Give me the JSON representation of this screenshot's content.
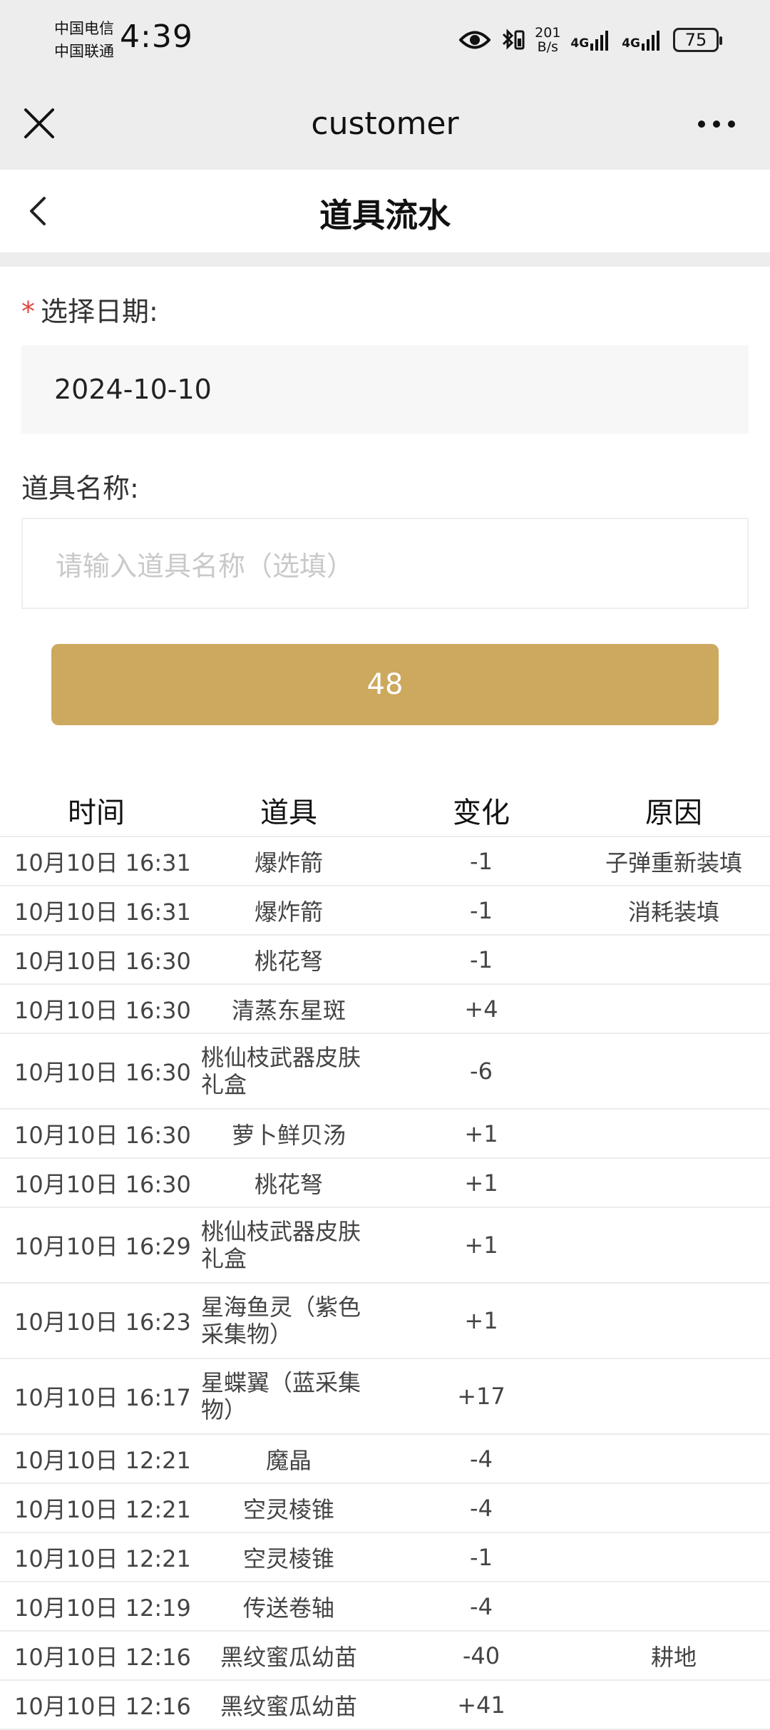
{
  "status": {
    "carrier1": "中国电信",
    "carrier2": "中国联通",
    "time": "4:39",
    "speed_value": "201",
    "speed_unit": "B/s",
    "net1": "4G",
    "net2": "4G",
    "battery": "75"
  },
  "nav": {
    "title": "customer"
  },
  "page": {
    "title": "道具流水"
  },
  "form": {
    "date_label": "选择日期:",
    "date_required": "*",
    "date_value": "2024-10-10",
    "name_label": "道具名称:",
    "name_placeholder": "请输入道具名称（选填）",
    "submit_label": "48"
  },
  "table": {
    "headers": {
      "time": "时间",
      "item": "道具",
      "change": "变化",
      "reason": "原因"
    },
    "rows": [
      {
        "time": "10月10日 16:31",
        "item": "爆炸箭",
        "change": "-1",
        "reason": "子弹重新装填"
      },
      {
        "time": "10月10日 16:31",
        "item": "爆炸箭",
        "change": "-1",
        "reason": "消耗装填"
      },
      {
        "time": "10月10日 16:30",
        "item": "桃花弩",
        "change": "-1",
        "reason": ""
      },
      {
        "time": "10月10日 16:30",
        "item": "清蒸东星斑",
        "change": "+4",
        "reason": ""
      },
      {
        "time": "10月10日 16:30",
        "item": "桃仙枝武器皮肤礼盒",
        "change": "-6",
        "reason": ""
      },
      {
        "time": "10月10日 16:30",
        "item": "萝卜鲜贝汤",
        "change": "+1",
        "reason": ""
      },
      {
        "time": "10月10日 16:30",
        "item": "桃花弩",
        "change": "+1",
        "reason": ""
      },
      {
        "time": "10月10日 16:29",
        "item": "桃仙枝武器皮肤礼盒",
        "change": "+1",
        "reason": ""
      },
      {
        "time": "10月10日 16:23",
        "item": "星海鱼灵（紫色采集物）",
        "change": "+1",
        "reason": ""
      },
      {
        "time": "10月10日 16:17",
        "item": "星蝶翼（蓝采集物）",
        "change": "+17",
        "reason": ""
      },
      {
        "time": "10月10日 12:21",
        "item": "魔晶",
        "change": "-4",
        "reason": ""
      },
      {
        "time": "10月10日 12:21",
        "item": "空灵棱锥",
        "change": "-4",
        "reason": ""
      },
      {
        "time": "10月10日 12:21",
        "item": "空灵棱锥",
        "change": "-1",
        "reason": ""
      },
      {
        "time": "10月10日 12:19",
        "item": "传送卷轴",
        "change": "-4",
        "reason": ""
      },
      {
        "time": "10月10日 12:16",
        "item": "黑纹蜜瓜幼苗",
        "change": "-40",
        "reason": "耕地"
      },
      {
        "time": "10月10日 12:16",
        "item": "黑纹蜜瓜幼苗",
        "change": "+41",
        "reason": ""
      }
    ]
  }
}
